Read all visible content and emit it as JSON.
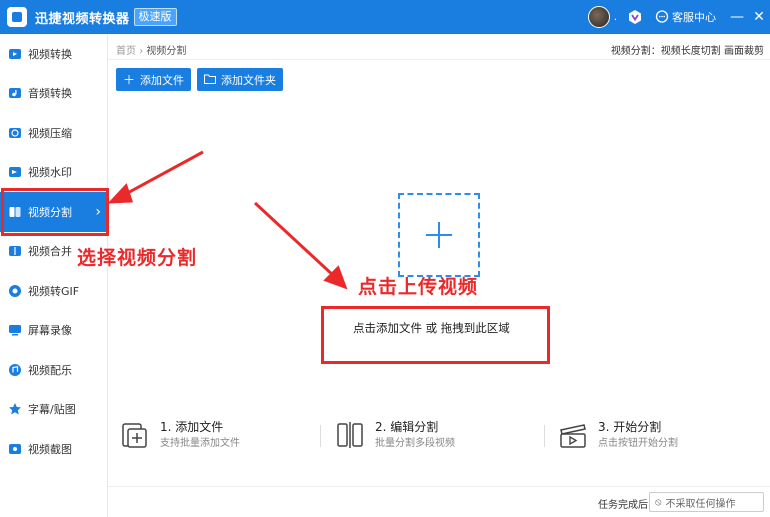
{
  "app": {
    "title": "迅捷视频转换器",
    "edition": "极速版",
    "user_dot": ".",
    "service_label": "客服中心",
    "minimize": "—",
    "close": "✕"
  },
  "sidebar": {
    "items": [
      {
        "label": "视频转换",
        "icon": "video-convert-icon"
      },
      {
        "label": "音频转换",
        "icon": "audio-convert-icon"
      },
      {
        "label": "视频压缩",
        "icon": "video-compress-icon"
      },
      {
        "label": "视频水印",
        "icon": "video-watermark-icon"
      },
      {
        "label": "视频分割",
        "icon": "video-split-icon",
        "active": true
      },
      {
        "label": "视频合并",
        "icon": "video-merge-icon"
      },
      {
        "label": "视频转GIF",
        "icon": "video-gif-icon"
      },
      {
        "label": "屏幕录像",
        "icon": "screen-record-icon"
      },
      {
        "label": "视频配乐",
        "icon": "video-music-icon"
      },
      {
        "label": "字幕/贴图",
        "icon": "subtitle-sticker-icon"
      },
      {
        "label": "视频截图",
        "icon": "video-screenshot-icon"
      }
    ]
  },
  "main": {
    "breadcrumb": {
      "home": "首页",
      "sep": "›",
      "current": "视频分割"
    },
    "tips": "视频分割：视频长度切割 画面裁剪",
    "toolbar": {
      "add_file": "添加文件",
      "add_folder": "添加文件夹"
    },
    "drop_hint": "点击添加文件 或 拖拽到此区域",
    "steps": [
      {
        "title": "1. 添加文件",
        "desc": "支持批量添加文件"
      },
      {
        "title": "2. 编辑分割",
        "desc": "批量分割多段视频"
      },
      {
        "title": "3. 开始分割",
        "desc": "点击按钮开始分割"
      }
    ],
    "footer": {
      "after_label": "任务完成后",
      "after_value": "不采取任何操作"
    }
  },
  "annotations": {
    "select_text": "选择视频分割",
    "upload_text": "点击上传视频"
  },
  "colors": {
    "brand": "#1a7de0",
    "annotation": "#ea2a2a",
    "dashed": "#2d8cf0"
  }
}
